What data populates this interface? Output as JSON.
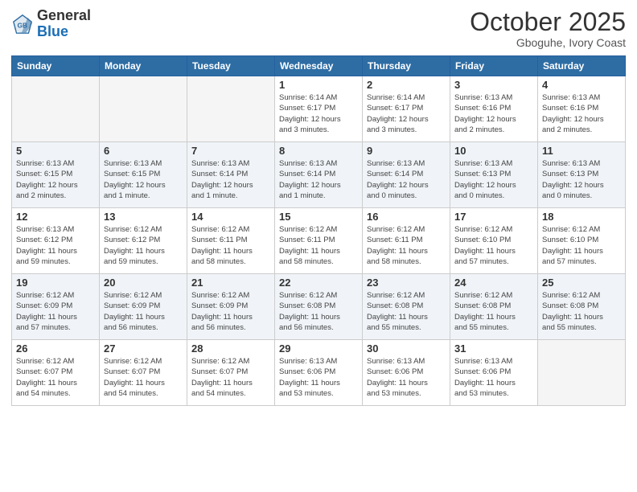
{
  "header": {
    "logo_general": "General",
    "logo_blue": "Blue",
    "month": "October 2025",
    "location": "Gboguhe, Ivory Coast"
  },
  "weekdays": [
    "Sunday",
    "Monday",
    "Tuesday",
    "Wednesday",
    "Thursday",
    "Friday",
    "Saturday"
  ],
  "weeks": [
    [
      {
        "day": "",
        "info": ""
      },
      {
        "day": "",
        "info": ""
      },
      {
        "day": "",
        "info": ""
      },
      {
        "day": "1",
        "info": "Sunrise: 6:14 AM\nSunset: 6:17 PM\nDaylight: 12 hours\nand 3 minutes."
      },
      {
        "day": "2",
        "info": "Sunrise: 6:14 AM\nSunset: 6:17 PM\nDaylight: 12 hours\nand 3 minutes."
      },
      {
        "day": "3",
        "info": "Sunrise: 6:13 AM\nSunset: 6:16 PM\nDaylight: 12 hours\nand 2 minutes."
      },
      {
        "day": "4",
        "info": "Sunrise: 6:13 AM\nSunset: 6:16 PM\nDaylight: 12 hours\nand 2 minutes."
      }
    ],
    [
      {
        "day": "5",
        "info": "Sunrise: 6:13 AM\nSunset: 6:15 PM\nDaylight: 12 hours\nand 2 minutes."
      },
      {
        "day": "6",
        "info": "Sunrise: 6:13 AM\nSunset: 6:15 PM\nDaylight: 12 hours\nand 1 minute."
      },
      {
        "day": "7",
        "info": "Sunrise: 6:13 AM\nSunset: 6:14 PM\nDaylight: 12 hours\nand 1 minute."
      },
      {
        "day": "8",
        "info": "Sunrise: 6:13 AM\nSunset: 6:14 PM\nDaylight: 12 hours\nand 1 minute."
      },
      {
        "day": "9",
        "info": "Sunrise: 6:13 AM\nSunset: 6:14 PM\nDaylight: 12 hours\nand 0 minutes."
      },
      {
        "day": "10",
        "info": "Sunrise: 6:13 AM\nSunset: 6:13 PM\nDaylight: 12 hours\nand 0 minutes."
      },
      {
        "day": "11",
        "info": "Sunrise: 6:13 AM\nSunset: 6:13 PM\nDaylight: 12 hours\nand 0 minutes."
      }
    ],
    [
      {
        "day": "12",
        "info": "Sunrise: 6:13 AM\nSunset: 6:12 PM\nDaylight: 11 hours\nand 59 minutes."
      },
      {
        "day": "13",
        "info": "Sunrise: 6:12 AM\nSunset: 6:12 PM\nDaylight: 11 hours\nand 59 minutes."
      },
      {
        "day": "14",
        "info": "Sunrise: 6:12 AM\nSunset: 6:11 PM\nDaylight: 11 hours\nand 58 minutes."
      },
      {
        "day": "15",
        "info": "Sunrise: 6:12 AM\nSunset: 6:11 PM\nDaylight: 11 hours\nand 58 minutes."
      },
      {
        "day": "16",
        "info": "Sunrise: 6:12 AM\nSunset: 6:11 PM\nDaylight: 11 hours\nand 58 minutes."
      },
      {
        "day": "17",
        "info": "Sunrise: 6:12 AM\nSunset: 6:10 PM\nDaylight: 11 hours\nand 57 minutes."
      },
      {
        "day": "18",
        "info": "Sunrise: 6:12 AM\nSunset: 6:10 PM\nDaylight: 11 hours\nand 57 minutes."
      }
    ],
    [
      {
        "day": "19",
        "info": "Sunrise: 6:12 AM\nSunset: 6:09 PM\nDaylight: 11 hours\nand 57 minutes."
      },
      {
        "day": "20",
        "info": "Sunrise: 6:12 AM\nSunset: 6:09 PM\nDaylight: 11 hours\nand 56 minutes."
      },
      {
        "day": "21",
        "info": "Sunrise: 6:12 AM\nSunset: 6:09 PM\nDaylight: 11 hours\nand 56 minutes."
      },
      {
        "day": "22",
        "info": "Sunrise: 6:12 AM\nSunset: 6:08 PM\nDaylight: 11 hours\nand 56 minutes."
      },
      {
        "day": "23",
        "info": "Sunrise: 6:12 AM\nSunset: 6:08 PM\nDaylight: 11 hours\nand 55 minutes."
      },
      {
        "day": "24",
        "info": "Sunrise: 6:12 AM\nSunset: 6:08 PM\nDaylight: 11 hours\nand 55 minutes."
      },
      {
        "day": "25",
        "info": "Sunrise: 6:12 AM\nSunset: 6:08 PM\nDaylight: 11 hours\nand 55 minutes."
      }
    ],
    [
      {
        "day": "26",
        "info": "Sunrise: 6:12 AM\nSunset: 6:07 PM\nDaylight: 11 hours\nand 54 minutes."
      },
      {
        "day": "27",
        "info": "Sunrise: 6:12 AM\nSunset: 6:07 PM\nDaylight: 11 hours\nand 54 minutes."
      },
      {
        "day": "28",
        "info": "Sunrise: 6:12 AM\nSunset: 6:07 PM\nDaylight: 11 hours\nand 54 minutes."
      },
      {
        "day": "29",
        "info": "Sunrise: 6:13 AM\nSunset: 6:06 PM\nDaylight: 11 hours\nand 53 minutes."
      },
      {
        "day": "30",
        "info": "Sunrise: 6:13 AM\nSunset: 6:06 PM\nDaylight: 11 hours\nand 53 minutes."
      },
      {
        "day": "31",
        "info": "Sunrise: 6:13 AM\nSunset: 6:06 PM\nDaylight: 11 hours\nand 53 minutes."
      },
      {
        "day": "",
        "info": ""
      }
    ]
  ]
}
